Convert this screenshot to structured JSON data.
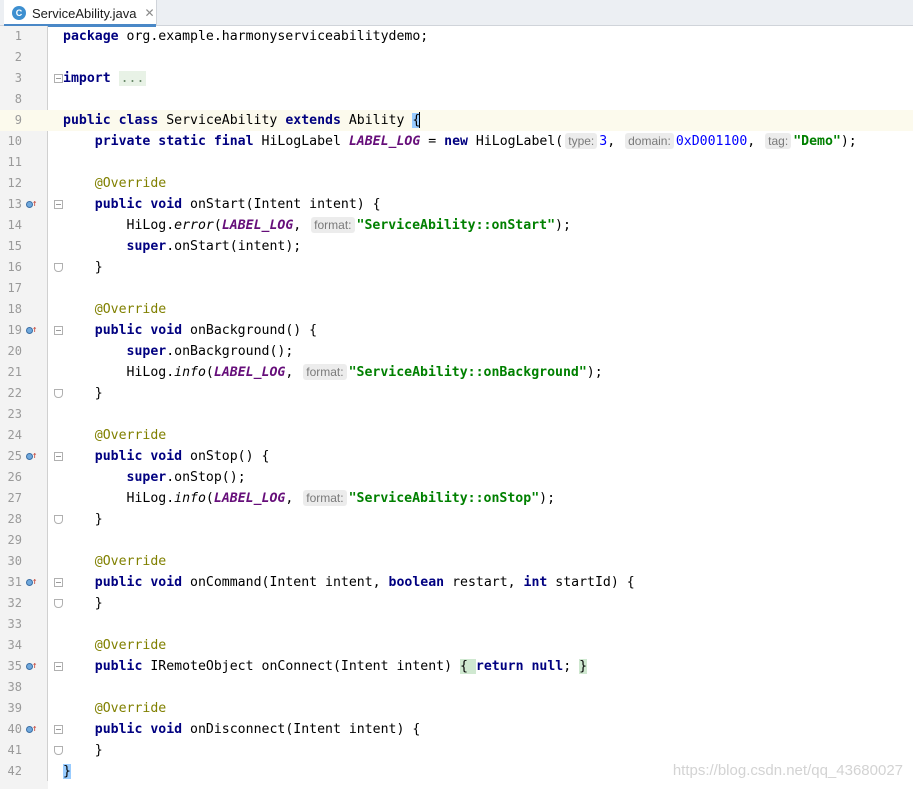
{
  "tab": {
    "icon_letter": "C",
    "filename": "ServiceAbility.java",
    "close_glyph": "✕"
  },
  "lines": [
    {
      "n": "1",
      "t": [
        {
          "c": "kw",
          "v": "package"
        },
        {
          "v": " org.example.harmonyserviceabilitydemo;"
        }
      ]
    },
    {
      "n": "2",
      "t": []
    },
    {
      "n": "3",
      "fold": "open",
      "t": [
        {
          "c": "kw",
          "v": "import"
        },
        {
          "v": " "
        },
        {
          "c": "folded",
          "v": "..."
        }
      ]
    },
    {
      "n": "8",
      "t": []
    },
    {
      "n": "9",
      "current": true,
      "t": [
        {
          "c": "kw",
          "v": "public class"
        },
        {
          "v": " ServiceAbility "
        },
        {
          "c": "kw",
          "v": "extends"
        },
        {
          "v": " Ability "
        },
        {
          "c": "brace-cur",
          "v": "{"
        }
      ]
    },
    {
      "n": "10",
      "t": [
        {
          "v": "    "
        },
        {
          "c": "kw",
          "v": "private static final"
        },
        {
          "v": " HiLogLabel "
        },
        {
          "c": "const",
          "v": "LABEL_LOG"
        },
        {
          "v": " = "
        },
        {
          "c": "kw",
          "v": "new"
        },
        {
          "v": " HiLogLabel("
        },
        {
          "c": "hint",
          "v": "type:"
        },
        {
          "c": "num",
          "v": "3"
        },
        {
          "v": ", "
        },
        {
          "c": "hint",
          "v": "domain:"
        },
        {
          "c": "num",
          "v": "0xD001100"
        },
        {
          "v": ", "
        },
        {
          "c": "hint",
          "v": "tag:"
        },
        {
          "c": "str",
          "v": "\"Demo\""
        },
        {
          "v": ");"
        }
      ]
    },
    {
      "n": "11",
      "t": []
    },
    {
      "n": "12",
      "t": [
        {
          "v": "    "
        },
        {
          "c": "ann",
          "v": "@Override"
        }
      ]
    },
    {
      "n": "13",
      "marker": true,
      "fold": "open",
      "t": [
        {
          "v": "    "
        },
        {
          "c": "kw",
          "v": "public void"
        },
        {
          "v": " onStart(Intent intent) {"
        }
      ]
    },
    {
      "n": "14",
      "t": [
        {
          "v": "        HiLog."
        },
        {
          "c": "it",
          "v": "error"
        },
        {
          "v": "("
        },
        {
          "c": "const",
          "v": "LABEL_LOG"
        },
        {
          "v": ", "
        },
        {
          "c": "hint",
          "v": "format:"
        },
        {
          "c": "str",
          "v": "\"ServiceAbility::onStart\""
        },
        {
          "v": ");"
        }
      ]
    },
    {
      "n": "15",
      "t": [
        {
          "v": "        "
        },
        {
          "c": "kw",
          "v": "super"
        },
        {
          "v": ".onStart(intent);"
        }
      ]
    },
    {
      "n": "16",
      "fold": "end",
      "t": [
        {
          "v": "    }"
        }
      ]
    },
    {
      "n": "17",
      "t": []
    },
    {
      "n": "18",
      "t": [
        {
          "v": "    "
        },
        {
          "c": "ann",
          "v": "@Override"
        }
      ]
    },
    {
      "n": "19",
      "marker": true,
      "fold": "open",
      "t": [
        {
          "v": "    "
        },
        {
          "c": "kw",
          "v": "public void"
        },
        {
          "v": " onBackground() {"
        }
      ]
    },
    {
      "n": "20",
      "t": [
        {
          "v": "        "
        },
        {
          "c": "kw",
          "v": "super"
        },
        {
          "v": ".onBackground();"
        }
      ]
    },
    {
      "n": "21",
      "t": [
        {
          "v": "        HiLog."
        },
        {
          "c": "it",
          "v": "info"
        },
        {
          "v": "("
        },
        {
          "c": "const",
          "v": "LABEL_LOG"
        },
        {
          "v": ", "
        },
        {
          "c": "hint",
          "v": "format:"
        },
        {
          "c": "str",
          "v": "\"ServiceAbility::onBackground\""
        },
        {
          "v": ");"
        }
      ]
    },
    {
      "n": "22",
      "fold": "end",
      "t": [
        {
          "v": "    }"
        }
      ]
    },
    {
      "n": "23",
      "t": []
    },
    {
      "n": "24",
      "t": [
        {
          "v": "    "
        },
        {
          "c": "ann",
          "v": "@Override"
        }
      ]
    },
    {
      "n": "25",
      "marker": true,
      "fold": "open",
      "t": [
        {
          "v": "    "
        },
        {
          "c": "kw",
          "v": "public void"
        },
        {
          "v": " onStop() {"
        }
      ]
    },
    {
      "n": "26",
      "t": [
        {
          "v": "        "
        },
        {
          "c": "kw",
          "v": "super"
        },
        {
          "v": ".onStop();"
        }
      ]
    },
    {
      "n": "27",
      "t": [
        {
          "v": "        HiLog."
        },
        {
          "c": "it",
          "v": "info"
        },
        {
          "v": "("
        },
        {
          "c": "const",
          "v": "LABEL_LOG"
        },
        {
          "v": ", "
        },
        {
          "c": "hint",
          "v": "format:"
        },
        {
          "c": "str",
          "v": "\"ServiceAbility::onStop\""
        },
        {
          "v": ");"
        }
      ]
    },
    {
      "n": "28",
      "fold": "end",
      "t": [
        {
          "v": "    }"
        }
      ]
    },
    {
      "n": "29",
      "t": []
    },
    {
      "n": "30",
      "t": [
        {
          "v": "    "
        },
        {
          "c": "ann",
          "v": "@Override"
        }
      ]
    },
    {
      "n": "31",
      "marker": true,
      "fold": "open",
      "t": [
        {
          "v": "    "
        },
        {
          "c": "kw",
          "v": "public void"
        },
        {
          "v": " onCommand(Intent intent, "
        },
        {
          "c": "kw",
          "v": "boolean"
        },
        {
          "v": " restart, "
        },
        {
          "c": "kw",
          "v": "int"
        },
        {
          "v": " startId) {"
        }
      ]
    },
    {
      "n": "32",
      "fold": "end",
      "t": [
        {
          "v": "    }"
        }
      ]
    },
    {
      "n": "33",
      "t": []
    },
    {
      "n": "34",
      "t": [
        {
          "v": "    "
        },
        {
          "c": "ann",
          "v": "@Override"
        }
      ]
    },
    {
      "n": "35",
      "marker": true,
      "fold": "open",
      "t": [
        {
          "v": "    "
        },
        {
          "c": "kw",
          "v": "public"
        },
        {
          "v": " IRemoteObject onConnect(Intent intent) "
        },
        {
          "c": "brace-hl",
          "v": "{ "
        },
        {
          "c": "kw",
          "v": "return null"
        },
        {
          "v": "; "
        },
        {
          "c": "brace-hl",
          "v": "}"
        }
      ]
    },
    {
      "n": "38",
      "t": []
    },
    {
      "n": "39",
      "t": [
        {
          "v": "    "
        },
        {
          "c": "ann",
          "v": "@Override"
        }
      ]
    },
    {
      "n": "40",
      "marker": true,
      "fold": "open",
      "t": [
        {
          "v": "    "
        },
        {
          "c": "kw",
          "v": "public void"
        },
        {
          "v": " onDisconnect(Intent intent) {"
        }
      ]
    },
    {
      "n": "41",
      "fold": "end",
      "t": [
        {
          "v": "    }"
        }
      ]
    },
    {
      "n": "42",
      "t": [
        {
          "c": "brace-cur",
          "v": "}"
        }
      ]
    }
  ],
  "watermark": "https://blog.csdn.net/qq_43680027"
}
